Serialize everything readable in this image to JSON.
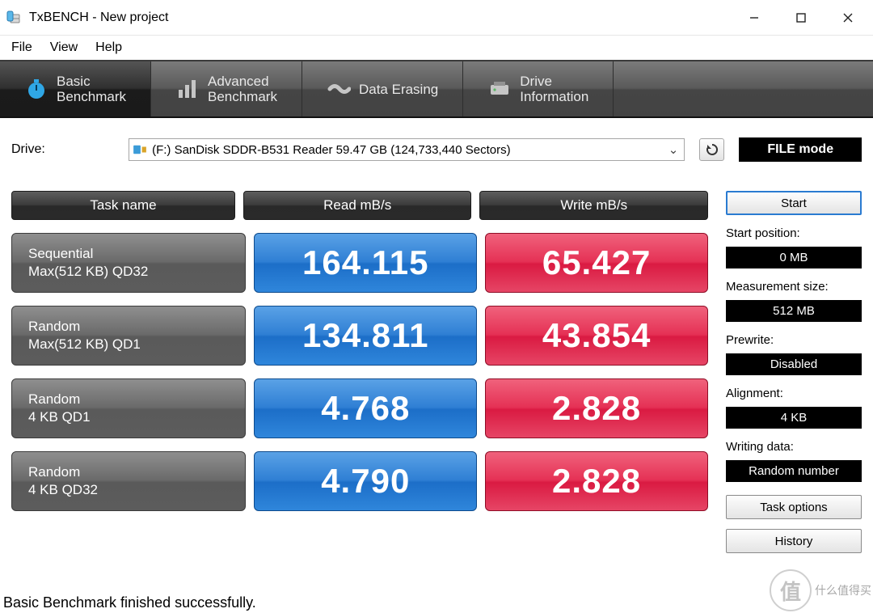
{
  "title": "TxBENCH - New project",
  "menu": {
    "file": "File",
    "view": "View",
    "help": "Help"
  },
  "tabs": [
    {
      "l1": "Basic",
      "l2": "Benchmark"
    },
    {
      "l1": "Advanced",
      "l2": "Benchmark"
    },
    {
      "l1": "Data Erasing",
      "l2": ""
    },
    {
      "l1": "Drive",
      "l2": "Information"
    }
  ],
  "drive_label": "Drive:",
  "drive_value": "(F:) SanDisk SDDR-B531 Reader  59.47 GB (124,733,440 Sectors)",
  "file_mode": "FILE mode",
  "headers": {
    "task": "Task name",
    "read": "Read mB/s",
    "write": "Write mB/s"
  },
  "rows": [
    {
      "n1": "Sequential",
      "n2": "Max(512 KB) QD32",
      "read": "164.115",
      "write": "65.427"
    },
    {
      "n1": "Random",
      "n2": "Max(512 KB) QD1",
      "read": "134.811",
      "write": "43.854"
    },
    {
      "n1": "Random",
      "n2": "4 KB QD1",
      "read": "4.768",
      "write": "2.828"
    },
    {
      "n1": "Random",
      "n2": "4 KB QD32",
      "read": "4.790",
      "write": "2.828"
    }
  ],
  "side": {
    "start": "Start",
    "start_pos_l": "Start position:",
    "start_pos_v": "0 MB",
    "meas_l": "Measurement size:",
    "meas_v": "512 MB",
    "prewrite_l": "Prewrite:",
    "prewrite_v": "Disabled",
    "align_l": "Alignment:",
    "align_v": "4 KB",
    "wdata_l": "Writing data:",
    "wdata_v": "Random number",
    "task_opts": "Task options",
    "history": "History"
  },
  "status": "Basic Benchmark finished successfully.",
  "watermark": "什么值得买"
}
